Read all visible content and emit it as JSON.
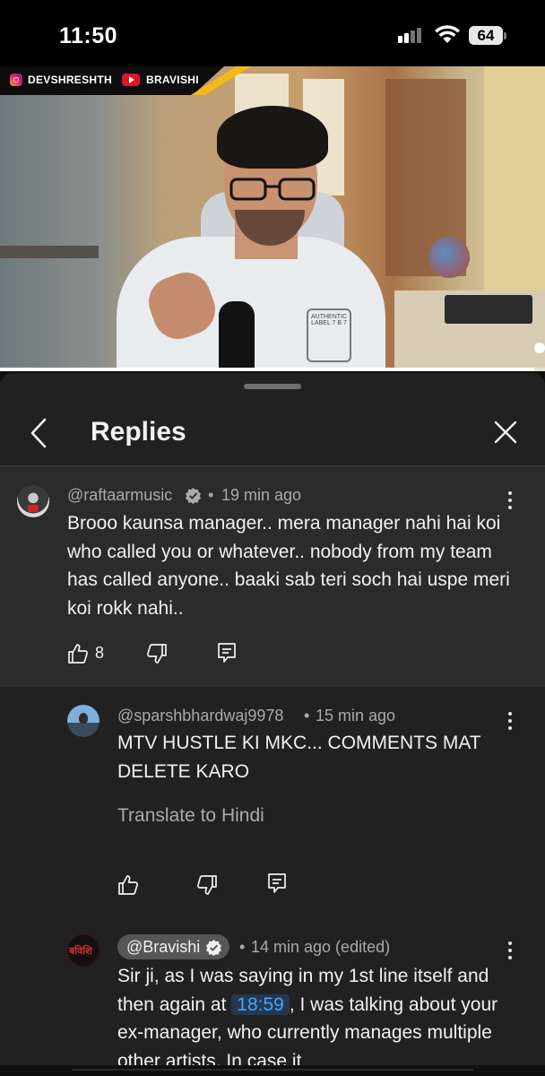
{
  "status_bar": {
    "time": "11:50",
    "battery": "64",
    "signal_icon": "cellular-signal-icon",
    "wifi_icon": "wifi-icon"
  },
  "video": {
    "overlay": {
      "instagram_handle": "DEVSHRESHTH",
      "youtube_channel": "BRAVISHI"
    },
    "progress_fraction": 0.98,
    "shirt_label": "AUTHENTIC LABEL 7 B 7"
  },
  "sheet": {
    "title": "Replies",
    "back_icon": "chevron-left-icon",
    "close_icon": "close-icon"
  },
  "main_comment": {
    "author": "@raftaarmusic",
    "separator": "•",
    "time": "19 min ago",
    "text": "Brooo kaunsa manager.. mera manager nahi hai koi who called you or whatever.. nobody from my team has called anyone.. baaki sab teri soch hai uspe meri koi rokk nahi..",
    "like_count": "8"
  },
  "replies": [
    {
      "author": "@sparshbhardwaj9978",
      "separator": "•",
      "time": "15 min ago",
      "text": "MTV HUSTLE KI MKC... COMMENTS MAT DELETE KARO",
      "translate_label": "Translate to Hindi"
    },
    {
      "author": "@Bravishi",
      "avatar_text": "बविशि",
      "separator": "•",
      "time": "14 min ago (edited)",
      "text_before": "Sir ji, as I was saying in my 1st line itself and then again at ",
      "timestamp": "18:59",
      "text_after": ", I was talking about your ex-manager, who currently manages multiple other artists. In case it"
    }
  ],
  "colors": {
    "background": "#0f0f0f",
    "sheet": "#212121",
    "highlight": "#2b2b2b",
    "link": "#3ea6ff",
    "banner_accent": "#f5b81a"
  }
}
